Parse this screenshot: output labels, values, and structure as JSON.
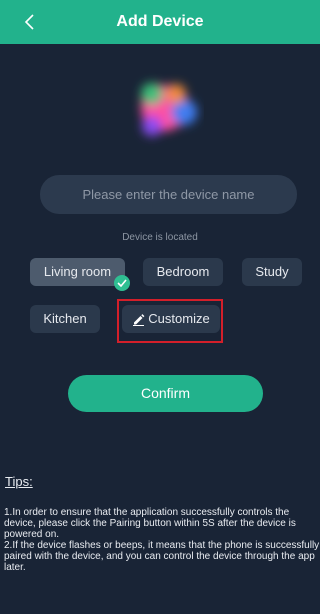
{
  "header": {
    "title": "Add Device"
  },
  "form": {
    "name_placeholder": "Please enter the device name"
  },
  "location": {
    "label": "Device is located",
    "options": [
      "Living room",
      "Bedroom",
      "Study",
      "Kitchen",
      "Customize"
    ],
    "selected": "Living room"
  },
  "confirm_label": "Confirm",
  "tips": {
    "title": "Tips:",
    "items": [
      "1.In order to ensure that the application successfully controls the device, please click the Pairing button within 5S after the device is powered on.",
      "2.If the device flashes or beeps, it means that the phone is successfully paired with the device, and you can control the device through the app later."
    ]
  },
  "colors": {
    "accent": "#22b28c",
    "background": "#192436",
    "highlight": "#d31f2a"
  },
  "icons": {
    "back": "chevron-left-icon",
    "check": "check-icon",
    "edit": "pencil-icon"
  }
}
